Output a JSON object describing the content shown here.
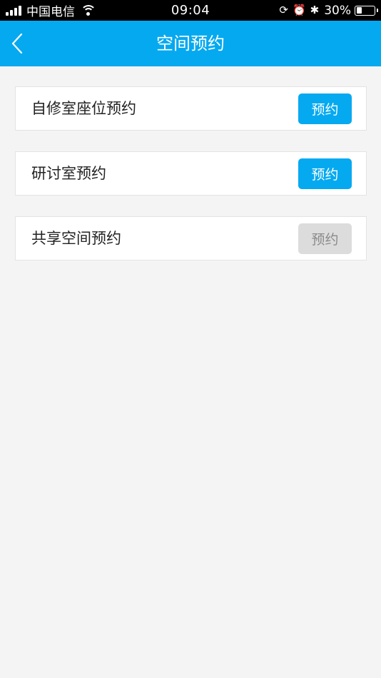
{
  "status_bar": {
    "carrier": "中国电信",
    "time": "09:04",
    "battery_percent": "30%",
    "battery_level": 0.3,
    "icons": [
      "signal-icon",
      "wifi-icon",
      "orientation-lock-icon",
      "alarm-icon",
      "bluetooth-icon",
      "battery-icon"
    ]
  },
  "nav": {
    "title": "空间预约",
    "back_icon": "chevron-left-icon"
  },
  "items": [
    {
      "label": "自修室座位预约",
      "button_label": "预约",
      "enabled": true
    },
    {
      "label": "研讨室预约",
      "button_label": "预约",
      "enabled": true
    },
    {
      "label": "共享空间预约",
      "button_label": "预约",
      "enabled": false
    }
  ],
  "colors": {
    "accent": "#05a9f0",
    "background": "#f4f4f4",
    "disabled_button": "#dcdcdc",
    "disabled_text": "#8a8a8a"
  }
}
